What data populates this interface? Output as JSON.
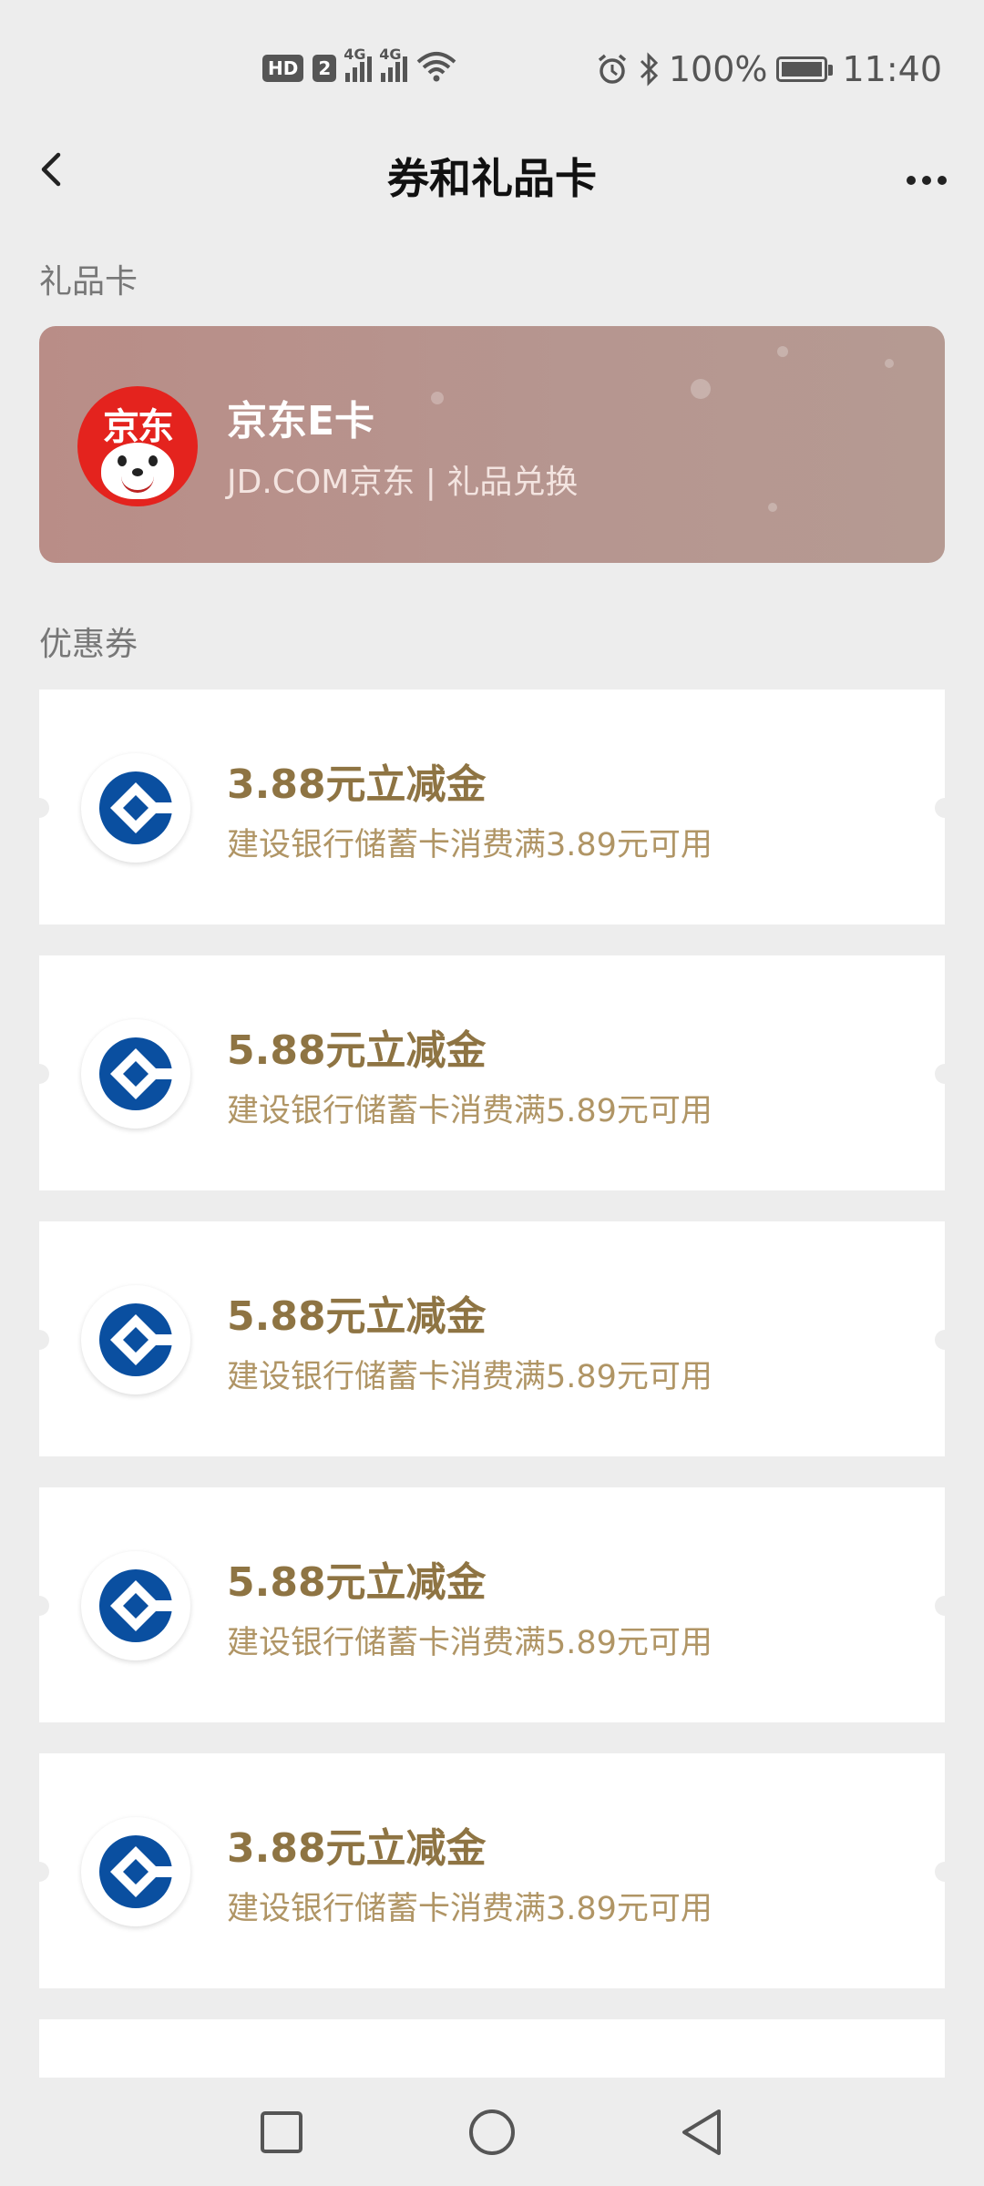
{
  "status_bar": {
    "hd": "HD",
    "sim": "2",
    "net1": "4G",
    "net2": "4G",
    "battery_pct": "100%",
    "time": "11:40"
  },
  "nav": {
    "title": "券和礼品卡"
  },
  "sections": {
    "gift_cards": "礼品卡",
    "coupons": "优惠券"
  },
  "gift_card": {
    "logo_text": "京东",
    "title": "京东E卡",
    "subtitle": "JD.COM京东 | 礼品兑换",
    "color": "#b98d87"
  },
  "coupons": [
    {
      "title": "3.88元立减金",
      "desc": "建设银行储蓄卡消费满3.89元可用"
    },
    {
      "title": "5.88元立减金",
      "desc": "建设银行储蓄卡消费满5.89元可用"
    },
    {
      "title": "5.88元立减金",
      "desc": "建设银行储蓄卡消费满5.89元可用"
    },
    {
      "title": "5.88元立减金",
      "desc": "建设银行储蓄卡消费满5.89元可用"
    },
    {
      "title": "3.88元立减金",
      "desc": "建设银行储蓄卡消费满3.89元可用"
    }
  ],
  "colors": {
    "coupon_title": "#8e7443",
    "coupon_desc": "#b09565",
    "ccb_blue": "#0a4fa0",
    "background": "#ededed"
  },
  "icons": {
    "back": "back-arrow-icon",
    "more": "more-dots-icon",
    "bank": "ccb-logo-icon",
    "nav_recent": "square-icon",
    "nav_home": "circle-icon",
    "nav_back": "triangle-back-icon"
  }
}
